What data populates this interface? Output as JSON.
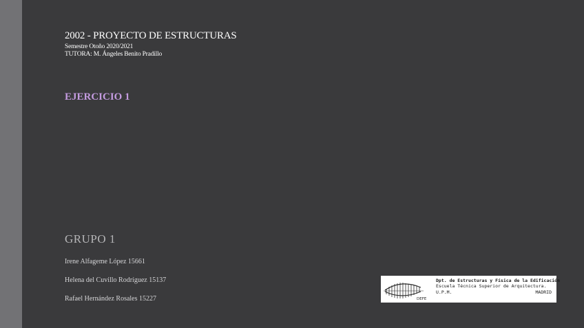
{
  "course": {
    "title": "2002 - PROYECTO DE ESTRUCTURAS",
    "semester": "Semestre Otoño 2020/2021",
    "tutor": "TUTORA: M. Ángeles Benito Pradillo"
  },
  "exercise": {
    "title": "EJERCICIO 1"
  },
  "group": {
    "title": "GRUPO 1",
    "members": [
      "Irene Alfageme López 15661",
      "Helena del Cuvillo Rodríguez 15137",
      "Rafael Hernández Rosales 15227"
    ]
  },
  "department_logo": {
    "emblem_text": "DEFE",
    "line1": "Dpt. de Estructuras y Física de la Edificación",
    "line2": "Escuela Técnica Superior de Arquitectura.",
    "line3_left": "U.P.M.",
    "line3_right": "MADRID"
  },
  "colors": {
    "background": "#3a3a3c",
    "side_strip": "#727275",
    "accent_purple": "#c49be0"
  }
}
